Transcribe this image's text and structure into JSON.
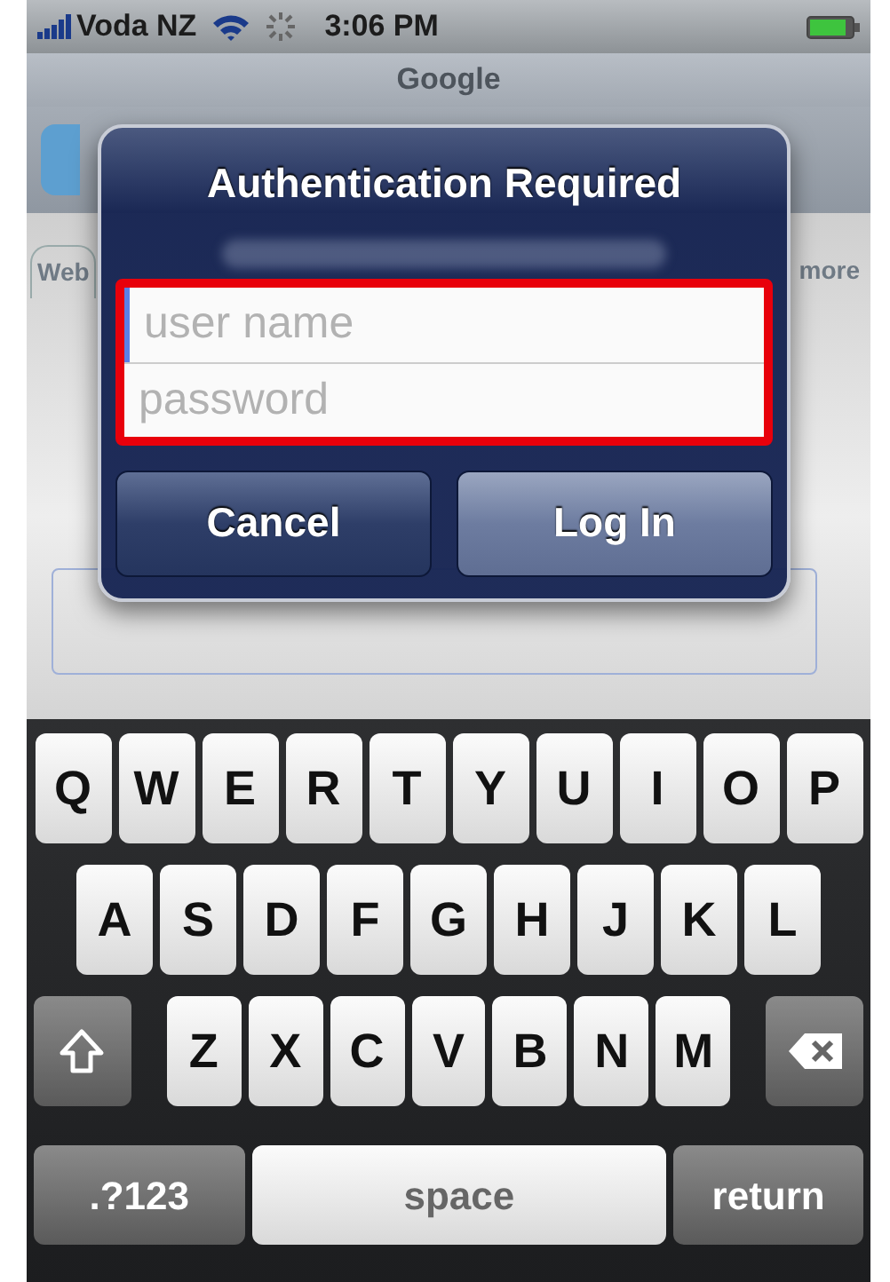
{
  "status_bar": {
    "carrier": "Voda NZ",
    "time": "3:06 PM"
  },
  "browser": {
    "title": "Google",
    "tabs": [
      {
        "label": "Web",
        "selected": true
      },
      {
        "label": "more",
        "selected": false
      }
    ]
  },
  "dialog": {
    "title": "Authentication Required",
    "highlighted": true,
    "fields": [
      {
        "placeholder": "user name",
        "focused": true
      },
      {
        "placeholder": "password",
        "focused": false
      }
    ],
    "buttons": [
      {
        "label": "Cancel",
        "kind": "cancel"
      },
      {
        "label": "Log In",
        "kind": "default"
      }
    ]
  },
  "keyboard": {
    "rows": [
      [
        {
          "label": "Q",
          "kind": "letter"
        },
        {
          "label": "W",
          "kind": "letter"
        },
        {
          "label": "E",
          "kind": "letter"
        },
        {
          "label": "R",
          "kind": "letter"
        },
        {
          "label": "T",
          "kind": "letter"
        },
        {
          "label": "Y",
          "kind": "letter"
        },
        {
          "label": "U",
          "kind": "letter"
        },
        {
          "label": "I",
          "kind": "letter"
        },
        {
          "label": "O",
          "kind": "letter"
        },
        {
          "label": "P",
          "kind": "letter"
        }
      ],
      [
        {
          "label": "A",
          "kind": "letter"
        },
        {
          "label": "S",
          "kind": "letter"
        },
        {
          "label": "D",
          "kind": "letter"
        },
        {
          "label": "F",
          "kind": "letter"
        },
        {
          "label": "G",
          "kind": "letter"
        },
        {
          "label": "H",
          "kind": "letter"
        },
        {
          "label": "J",
          "kind": "letter"
        },
        {
          "label": "K",
          "kind": "letter"
        },
        {
          "label": "L",
          "kind": "letter"
        }
      ],
      [
        {
          "kind": "shift"
        },
        {
          "label": "Z",
          "kind": "letter"
        },
        {
          "label": "X",
          "kind": "letter"
        },
        {
          "label": "C",
          "kind": "letter"
        },
        {
          "label": "V",
          "kind": "letter"
        },
        {
          "label": "B",
          "kind": "letter"
        },
        {
          "label": "N",
          "kind": "letter"
        },
        {
          "label": "M",
          "kind": "letter"
        },
        {
          "kind": "delete"
        }
      ]
    ],
    "bottom_keys": [
      {
        "label": ".?123",
        "kind": "mode"
      },
      {
        "label": "space",
        "kind": "space"
      },
      {
        "label": "return",
        "kind": "return"
      }
    ]
  }
}
